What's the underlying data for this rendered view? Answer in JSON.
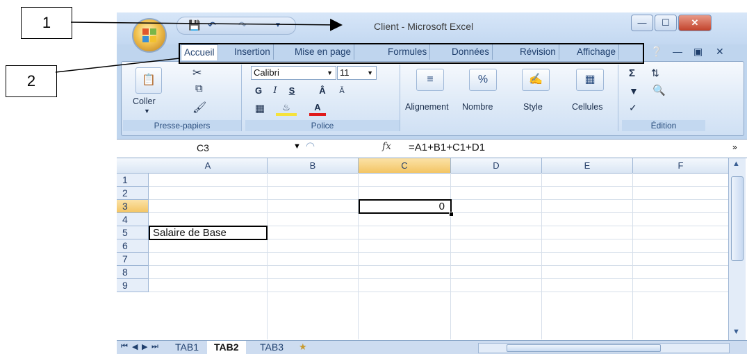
{
  "annotations": {
    "callout_1": "1",
    "callout_2": "2"
  },
  "window": {
    "title": "Client - Microsoft Excel",
    "buttons": {
      "minimize": "—",
      "maximize": "☐",
      "close": "✕"
    }
  },
  "tabs": [
    {
      "label": "Accueil"
    },
    {
      "label": "Insertion"
    },
    {
      "label": "Mise en page"
    },
    {
      "label": "Formules"
    },
    {
      "label": "Données"
    },
    {
      "label": "Révision"
    },
    {
      "label": "Affichage"
    }
  ],
  "ribbon": {
    "clipboard": {
      "paste_label": "Coller",
      "group_label": "Presse-papiers"
    },
    "font": {
      "font_name": "Calibri",
      "font_size": "11",
      "bold": "G",
      "italic": "I",
      "underline": "S",
      "group_label": "Police"
    },
    "alignment_label": "Alignement",
    "number_label": "Nombre",
    "style_label": "Style",
    "cells_label": "Cellules",
    "editing_group_label": "Édition"
  },
  "formula_bar": {
    "name_box": "C3",
    "fx": "fx",
    "formula": "=A1+B1+C1+D1"
  },
  "columns": [
    "A",
    "B",
    "C",
    "D",
    "E",
    "F"
  ],
  "rows": [
    "1",
    "2",
    "3",
    "4",
    "5",
    "6",
    "7",
    "8",
    "9"
  ],
  "cells": {
    "C3": "0",
    "A5": "Salaire de Base"
  },
  "sheets": [
    "TAB1",
    "TAB2",
    "TAB3"
  ]
}
